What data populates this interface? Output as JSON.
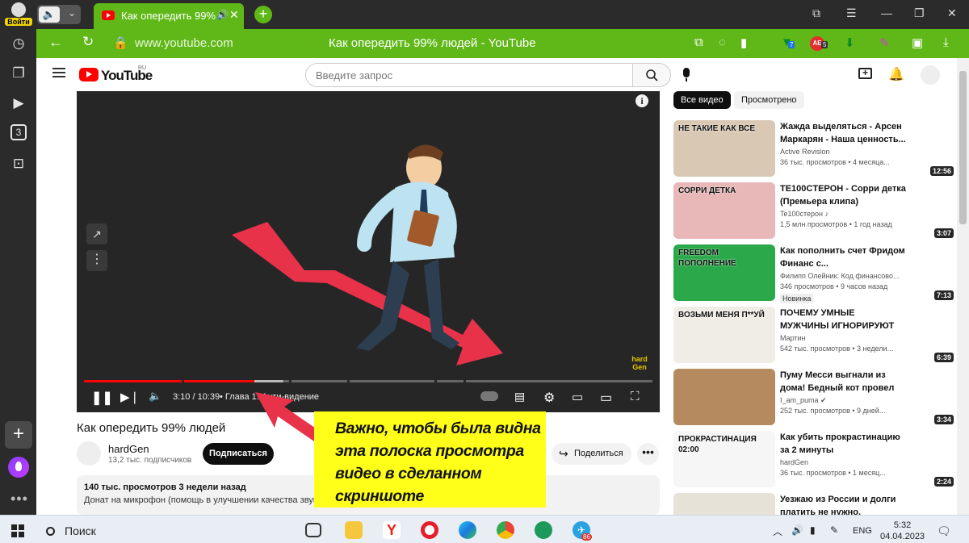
{
  "browser": {
    "login_label": "Войти",
    "tab_title": "Как опередить 99%",
    "address_url": "www.youtube.com",
    "page_title": "Как опередить 99% людей - YouTube",
    "badges": {
      "bookmarks_count": "7",
      "ae_count": "5"
    }
  },
  "youtube": {
    "brand": "YouTube",
    "region": "RU",
    "search_placeholder": "Введите запрос"
  },
  "player": {
    "time": "3:10 / 10:39",
    "chapter": "• Глава 1. Анти-видение",
    "watermark": "hard Gen",
    "progress_fraction": 0.3,
    "buffered_fraction": 0.35,
    "segments": [
      {
        "start": 0.0,
        "end": 0.172
      },
      {
        "start": 0.176,
        "end": 0.361
      },
      {
        "start": 0.365,
        "end": 0.463
      },
      {
        "start": 0.467,
        "end": 0.617
      },
      {
        "start": 0.621,
        "end": 0.668
      },
      {
        "start": 0.672,
        "end": 1.0
      }
    ]
  },
  "video": {
    "title": "Как опередить 99% людей",
    "channel": "hardGen",
    "subscribers": "13,2 тыс. подписчиков",
    "subscribe_label": "Подписаться",
    "share_label": "Поделиться",
    "stats": "140 тыс. просмотров  3 недели назад",
    "description": "Донат на микрофон (помощь в улучшении качества звука):"
  },
  "callout": {
    "lines": [
      "Важно, чтобы была видна",
      "эта полоска просмотра",
      "видео в сделанном",
      "скриншоте"
    ]
  },
  "filters": [
    "Все видео",
    "Просмотрено"
  ],
  "recommendations": [
    {
      "title": "Жажда выделяться - Арсен Маркарян - Наша ценность...",
      "channel": "Active Revision",
      "meta": "36 тыс. просмотров  • 4 месяца...",
      "duration": "12:56",
      "thumb_color": "#d9c8b4",
      "thumb_text": "НЕ ТАКИЕ  КАК ВСЕ"
    },
    {
      "title": "TE100CTEPOH - Сорри детка (Премьера клипа)",
      "channel": "Te100стерон ♪",
      "meta": "1,5 млн просмотров  • 1 год назад",
      "duration": "3:07",
      "thumb_color": "#e8b7b8",
      "thumb_text": "СОРРИ ДЕТКА"
    },
    {
      "title": "Как пополнить счет Фридом Финанс с...",
      "channel": "Филипп Олейник: Код финансово...",
      "meta": "346 просмотров  • 9 часов назад",
      "duration": "7:13",
      "badge": "Новинка",
      "thumb_color": "#2aa84a",
      "thumb_text": "FREEDOM  ПОПОЛНЕНИЕ"
    },
    {
      "title": "ПОЧЕМУ УМНЫЕ МУЖЧИНЫ ИГНОРИРУЮТ ЖЕНЩИН (Я...",
      "channel": "Мартин",
      "meta": "542 тыс. просмотров  • 3 недели...",
      "duration": "6:39",
      "thumb_color": "#f0ece6",
      "thumb_text": "ВОЗЬМИ МЕНЯ  П**УЙ"
    },
    {
      "title": "Пуму Месси выгнали из дома! Бедный кот провел пол дня...",
      "channel": "I_am_puma ✔",
      "meta": "252 тыс. просмотров  • 9 дней...",
      "duration": "3:34",
      "thumb_color": "#b58a5e",
      "thumb_text": ""
    },
    {
      "title": "Как убить прокрастинацию за 2 минуты",
      "channel": "hardGen",
      "meta": "36 тыс. просмотров  • 1 месяц...",
      "duration": "2:24",
      "thumb_color": "#f6f6f6",
      "thumb_text": "ПРОКРАСТИНАЦИЯ  02:00"
    },
    {
      "title": "Уезжаю из России и долги платить не нужно. Разговор...",
      "channel": "",
      "meta": "",
      "duration": "",
      "thumb_color": "#e7e2d8",
      "thumb_text": ""
    }
  ],
  "taskbar": {
    "search_label": "Поиск",
    "lang": "ENG",
    "time": "5:32",
    "date": "04.04.2023",
    "telegram_badge": "86"
  },
  "colors": {
    "browser_green": "#5fb817",
    "yt_red": "#ff0000",
    "callout_yellow": "#ffff1a",
    "arrow_red": "#e8324a"
  }
}
